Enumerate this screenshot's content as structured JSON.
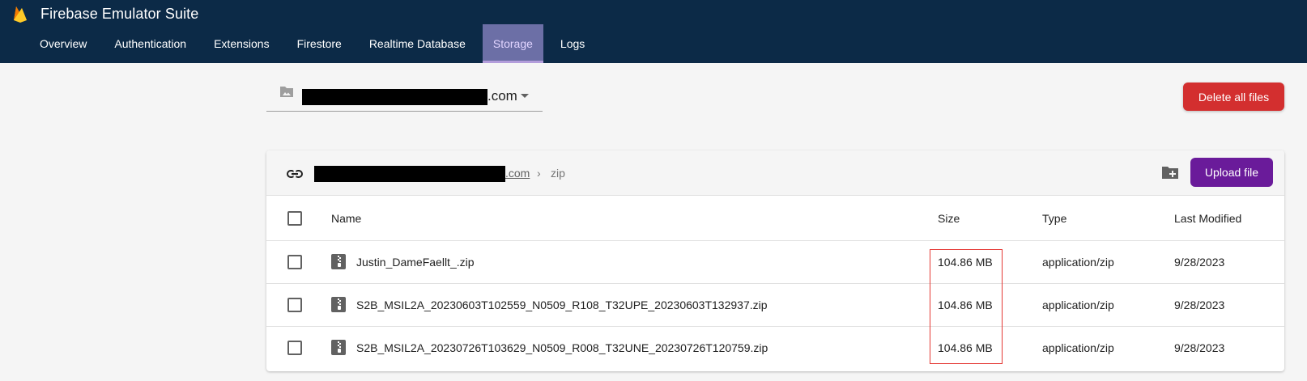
{
  "header": {
    "title": "Firebase Emulator Suite",
    "logo_icon": "firebase-flame-icon",
    "tabs": [
      {
        "label": "Overview",
        "active": false
      },
      {
        "label": "Authentication",
        "active": false
      },
      {
        "label": "Extensions",
        "active": false
      },
      {
        "label": "Firestore",
        "active": false
      },
      {
        "label": "Realtime Database",
        "active": false
      },
      {
        "label": "Storage",
        "active": true
      },
      {
        "label": "Logs",
        "active": false
      }
    ]
  },
  "bucket_selector": {
    "value_suffix": ".com",
    "icon": "folder-image-icon"
  },
  "actions": {
    "delete_all_label": "Delete all files",
    "upload_label": "Upload file"
  },
  "breadcrumb": {
    "bucket_suffix": ".com",
    "separator": "›",
    "folder": "zip"
  },
  "table": {
    "columns": {
      "name": "Name",
      "size": "Size",
      "type": "Type",
      "modified": "Last Modified"
    },
    "rows": [
      {
        "name": "Justin_DameFaellt_.zip",
        "size": "104.86 MB",
        "type": "application/zip",
        "modified": "9/28/2023"
      },
      {
        "name": "S2B_MSIL2A_20230603T102559_N0509_R108_T32UPE_20230603T132937.zip",
        "size": "104.86 MB",
        "type": "application/zip",
        "modified": "9/28/2023"
      },
      {
        "name": "S2B_MSIL2A_20230726T103629_N0509_R008_T32UNE_20230726T120759.zip",
        "size": "104.86 MB",
        "type": "application/zip",
        "modified": "9/28/2023"
      }
    ]
  },
  "colors": {
    "header_bg": "#0c2a47",
    "active_tab_bg": "#6c6fa6",
    "delete_button": "#d32f2f",
    "upload_button": "#6a1b9a",
    "highlight_border": "#e53935"
  }
}
